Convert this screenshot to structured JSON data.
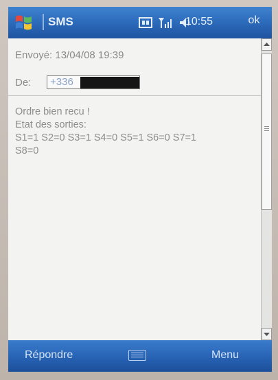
{
  "titlebar": {
    "app_title": "SMS",
    "time": "10:55",
    "ok_label": "ok"
  },
  "message": {
    "sent_line": "Envoyé: 13/04/08 19:39",
    "from_label": "De:",
    "from_value": "+336",
    "body_lines": [
      "Ordre bien recu !",
      "Etat des sorties:",
      "S1=1 S2=0 S3=1 S4=0 S5=1 S6=0 S7=1",
      "S8=0"
    ]
  },
  "softkeys": {
    "left": "Répondre",
    "right": "Menu"
  },
  "colors": {
    "bar_blue": "#2a67b7",
    "content_bg": "#f3f3f2",
    "text_gray": "#8d8e8b"
  }
}
